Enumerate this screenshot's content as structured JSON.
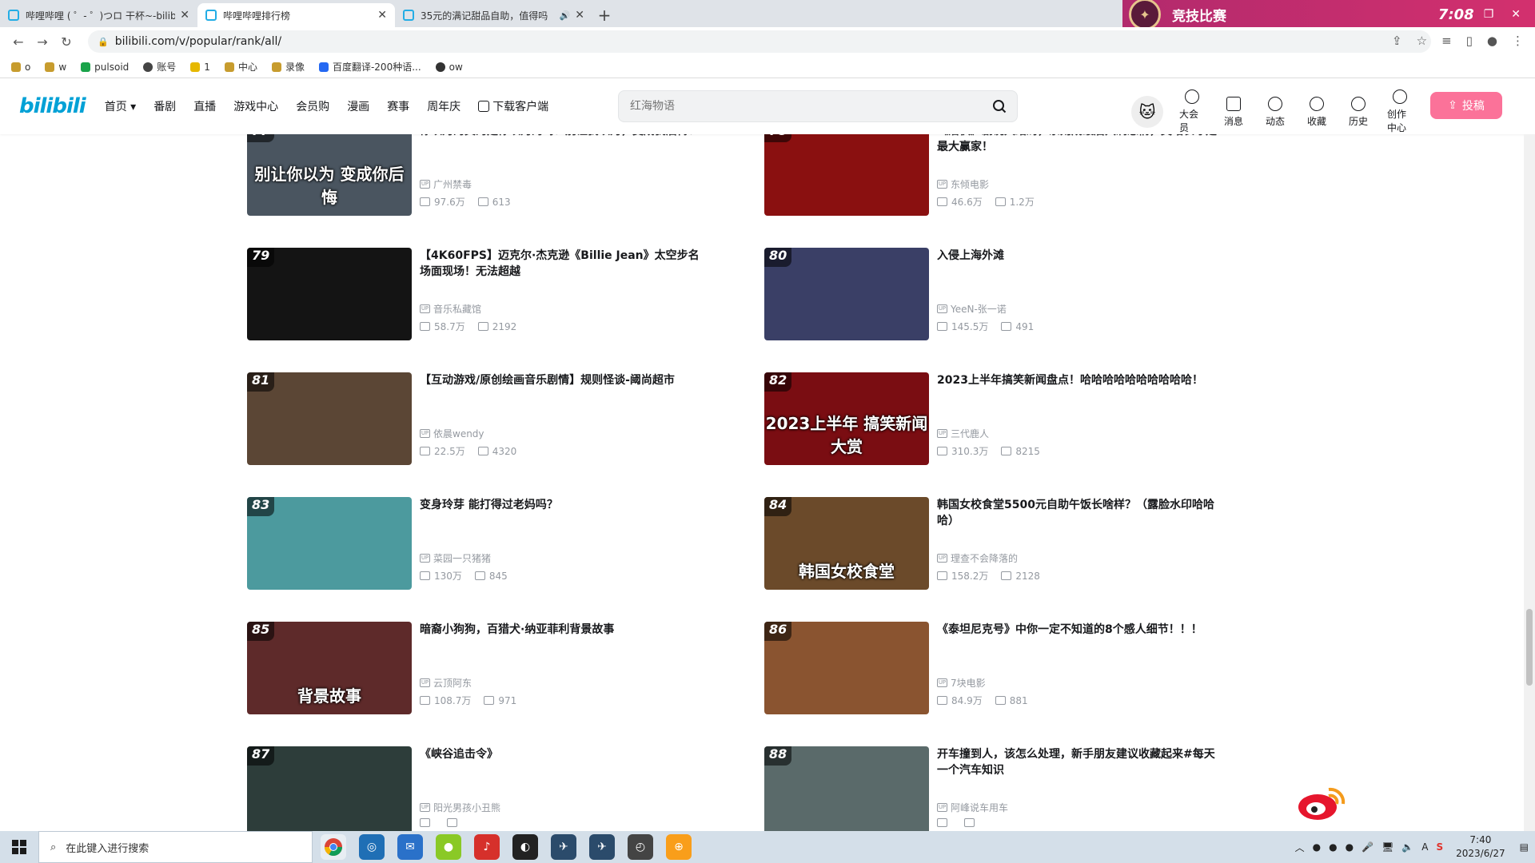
{
  "browser": {
    "tabs": [
      {
        "title": "哔哩哔哩 ( ゜- ゜)つロ 干杯~-bilib",
        "active": false
      },
      {
        "title": "哔哩哔哩排行榜",
        "active": true
      },
      {
        "title": "35元的满记甜品自助，值得吗",
        "active": false
      }
    ],
    "url": "bilibili.com/v/popular/rank/all/",
    "bookmarks": [
      "o",
      "w",
      "pulsoid",
      "账号",
      "1",
      "中心",
      "录像",
      "百度翻译-200种语...",
      "ow"
    ]
  },
  "game_banner": {
    "label": "竞技比赛",
    "time": "7:08"
  },
  "bili": {
    "logo": "bilibili",
    "nav": [
      "首页",
      "番剧",
      "直播",
      "游戏中心",
      "会员购",
      "漫画",
      "赛事",
      "周年庆",
      "下载客户端"
    ],
    "search_placeholder": "红海物语",
    "header_items": [
      "大会员",
      "消息",
      "动态",
      "收藏",
      "历史",
      "创作中心"
    ],
    "upload_label": "投稿"
  },
  "items": [
    {
      "rank": "77",
      "title": "你以为的真的是你以为的吗？别让我以为，变成我后悔！",
      "up": "广州禁毒",
      "views": "97.6万",
      "comments": "613",
      "caption": "别让你以为 变成你后悔",
      "color": "#4a5560"
    },
    {
      "rank": "78",
      "title": "《潜伏》剧说大结局，余则成最后只剩悲情，吴站长才是最大赢家！",
      "up": "东倾电影",
      "views": "46.6万",
      "comments": "1.2万",
      "caption": "",
      "color": "#8a1010"
    },
    {
      "rank": "79",
      "title": "【4K60FPS】迈克尔·杰克逊《Billie Jean》太空步名场面现场！无法超越",
      "up": "音乐私藏馆",
      "views": "58.7万",
      "comments": "2192",
      "caption": "",
      "color": "#141414"
    },
    {
      "rank": "80",
      "title": "入侵上海外滩",
      "up": "YeeN-张一诺",
      "views": "145.5万",
      "comments": "491",
      "caption": "",
      "color": "#3a3f66"
    },
    {
      "rank": "81",
      "title": "【互动游戏/原创绘画音乐剧情】规则怪谈-阈尚超市",
      "up": "依晨wendy",
      "views": "22.5万",
      "comments": "4320",
      "caption": "",
      "color": "#5b4635"
    },
    {
      "rank": "82",
      "title": "2023上半年搞笑新闻盘点！哈哈哈哈哈哈哈哈哈哈！",
      "up": "三代鹿人",
      "views": "310.3万",
      "comments": "8215",
      "caption": "2023上半年 搞笑新闻大赏",
      "color": "#7a0d12"
    },
    {
      "rank": "83",
      "title": "变身玲芽 能打得过老妈吗？",
      "up": "菜园一只猪猪",
      "views": "130万",
      "comments": "845",
      "caption": "",
      "color": "#4c9a9e"
    },
    {
      "rank": "84",
      "title": "韩国女校食堂5500元自助午饭长啥样？（露脸水印哈哈哈）",
      "up": "理查不会降落的",
      "views": "158.2万",
      "comments": "2128",
      "caption": "韩国女校食堂",
      "color": "#6b4a2a"
    },
    {
      "rank": "85",
      "title": "暗裔小狗狗，百猎犬·纳亚菲利背景故事",
      "up": "云顶阿东",
      "views": "108.7万",
      "comments": "971",
      "caption": "背景故事",
      "color": "#5e2a2a"
    },
    {
      "rank": "86",
      "title": "《泰坦尼克号》中你一定不知道的8个感人细节！！！",
      "up": "7块电影",
      "views": "84.9万",
      "comments": "881",
      "caption": "",
      "color": "#8a5430"
    },
    {
      "rank": "87",
      "title": "《峡谷追击令》",
      "up": "阳光男孩小丑熊",
      "views": "",
      "comments": "",
      "caption": "",
      "color": "#2d3d3a"
    },
    {
      "rank": "88",
      "title": "开车撞到人，该怎么处理，新手朋友建议收藏起来#每天一个汽车知识",
      "up": "阿峰说车用车",
      "views": "",
      "comments": "",
      "caption": "",
      "color": "#5a6a6a"
    }
  ],
  "taskbar": {
    "search_placeholder": "在此键入进行搜索",
    "time": "7:40",
    "date": "2023/6/27"
  }
}
